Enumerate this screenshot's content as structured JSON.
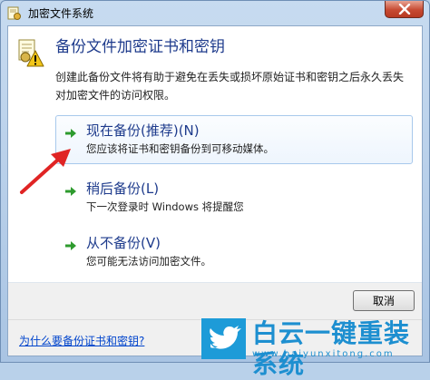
{
  "window": {
    "title": "加密文件系统",
    "heading": "备份文件加密证书和密钥",
    "description": "创建此备份文件将有助于避免在丢失或损坏原始证书和密钥之后永久丢失对加密文件的访问权限。"
  },
  "options": [
    {
      "title": "现在备份(推荐)(N)",
      "subtitle": "您应该将证书和密钥备份到可移动媒体。",
      "selected": true
    },
    {
      "title": "稍后备份(L)",
      "subtitle": "下一次登录时 Windows 将提醒您",
      "selected": false
    },
    {
      "title": "从不备份(V)",
      "subtitle": "您可能无法访问加密文件。",
      "selected": false
    }
  ],
  "footer": {
    "cancel_label": "取消",
    "help_link": "为什么要备份证书和密钥?"
  },
  "watermark": {
    "main": "白云一键重装系统",
    "url": "www.baiyunxitong.com"
  },
  "colors": {
    "heading_blue": "#1e3b8c",
    "arrow_green": "#2e9b2e",
    "annotation_red": "#e02424",
    "watermark_blue": "#1d8fd0"
  },
  "icons": {
    "title": "certificate-lock-icon",
    "option_arrow": "green-arrow-icon",
    "close": "close-x-icon"
  }
}
